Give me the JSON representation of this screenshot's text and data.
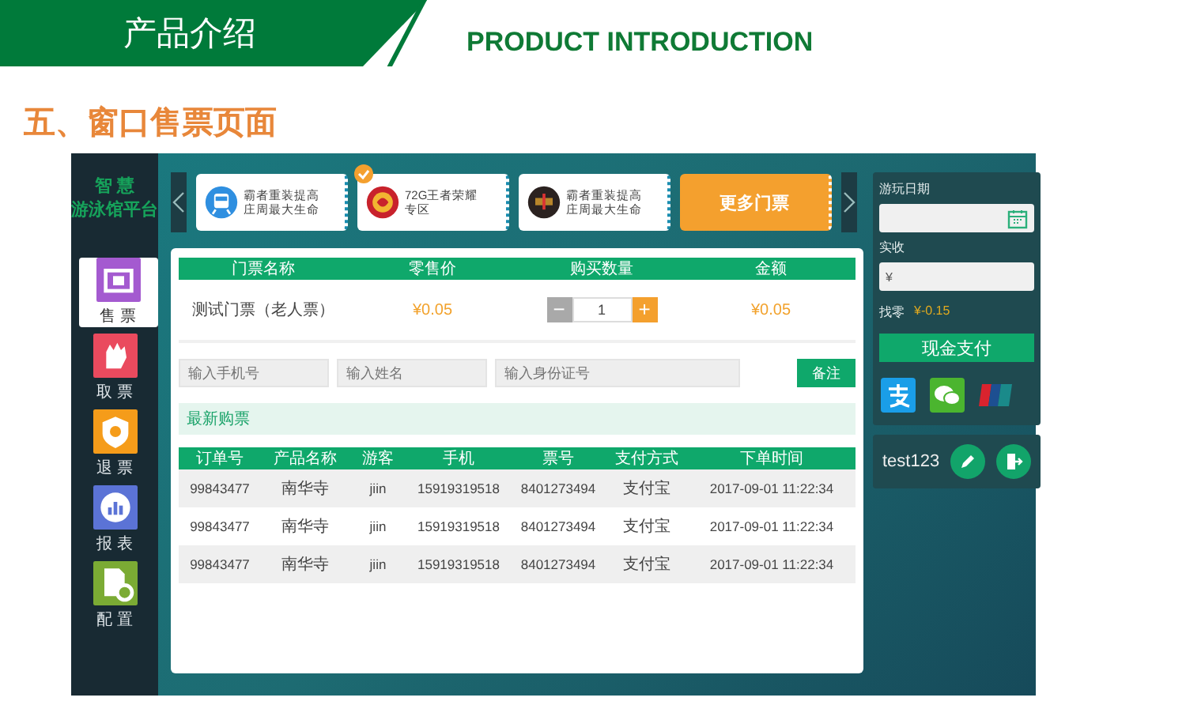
{
  "header": {
    "title": "产品介绍",
    "subtitle": "PRODUCT INTRODUCTION"
  },
  "section_title": "五、窗口售票页面",
  "app": {
    "logo": [
      "智 慧",
      "游泳馆平台"
    ],
    "nav": [
      {
        "label": "售 票",
        "color": "#a45ad0",
        "selected": true
      },
      {
        "label": "取 票",
        "color": "#ea4a5e",
        "selected": false
      },
      {
        "label": "退 票",
        "color": "#f59c1a",
        "selected": false
      },
      {
        "label": "报 表",
        "color": "#5b73d6",
        "selected": false
      },
      {
        "label": "配 置",
        "color": "#7bab34",
        "selected": false
      }
    ],
    "tickets": [
      {
        "text": "霸者重装提高庄周最大生命",
        "selected": false
      },
      {
        "text": "72G王者荣耀专区",
        "selected": true
      },
      {
        "text": "霸者重装提高庄周最大生命",
        "selected": false
      }
    ],
    "more_tickets": "更多门票",
    "order_table": {
      "columns": [
        "门票名称",
        "零售价",
        "购买数量",
        "金额"
      ],
      "rows": [
        {
          "name": "测试门票（老人票）",
          "price": "¥0.05",
          "quantity": "1",
          "amount": "¥0.05",
          "minus": "−",
          "plus": "+"
        }
      ]
    },
    "inputs": [
      {
        "placeholder": "输入手机号"
      },
      {
        "placeholder": "输入姓名"
      },
      {
        "placeholder": "输入身份证号"
      }
    ],
    "note_button": "备注",
    "recent_title": "最新购票",
    "recent_table": {
      "columns": [
        "订单号",
        "产品名称",
        "游客",
        "手机",
        "票号",
        "支付方式",
        "下单时间"
      ],
      "rows": [
        [
          "99843477",
          "南华寺",
          "jiin",
          "15919319518",
          "8401273494",
          "支付宝",
          "2017-09-01 11:22:34"
        ],
        [
          "99843477",
          "南华寺",
          "jiin",
          "15919319518",
          "8401273494",
          "支付宝",
          "2017-09-01 11:22:34"
        ],
        [
          "99843477",
          "南华寺",
          "jiin",
          "15919319518",
          "8401273494",
          "支付宝",
          "2017-09-01 11:22:34"
        ]
      ]
    },
    "payment": {
      "date_label": "游玩日期",
      "received_label": "实收",
      "received_value": "¥",
      "change_label": "找零",
      "change_value": "¥-0.15",
      "cash_button": "现金支付"
    },
    "user": {
      "name": "test123"
    }
  }
}
